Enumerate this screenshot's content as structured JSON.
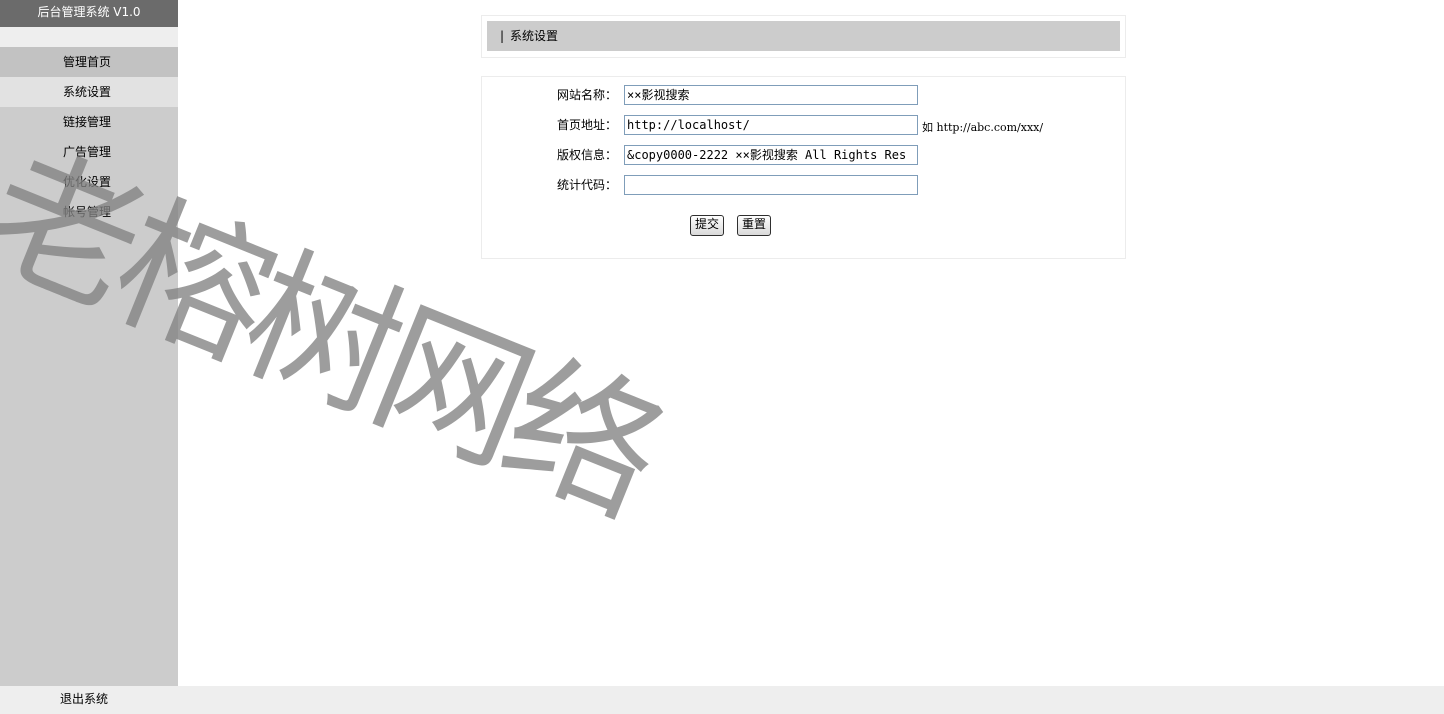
{
  "sidebar": {
    "title": "后台管理系统 V1.0",
    "items": [
      {
        "label": "管理首页"
      },
      {
        "label": "系统设置"
      },
      {
        "label": "链接管理"
      },
      {
        "label": "广告管理"
      },
      {
        "label": "优化设置"
      },
      {
        "label": "帐号管理"
      }
    ]
  },
  "footer": {
    "logout_label": "退出系统"
  },
  "main": {
    "section_separator": "|",
    "section_title": "系统设置",
    "form": {
      "site_name": {
        "label": "网站名称：",
        "value": "××影视搜索"
      },
      "home_url": {
        "label": "首页地址：",
        "value": "http://localhost/",
        "hint_prefix": "如",
        "hint_url": "http://abc.com/xxx/"
      },
      "copyright": {
        "label": "版权信息：",
        "value": "&copy0000-2222 ××影视搜索 All Rights Res"
      },
      "stats_code": {
        "label": "统计代码：",
        "value": ""
      },
      "submit_label": "提交",
      "reset_label": "重置"
    }
  },
  "watermark": "老榕树网络"
}
